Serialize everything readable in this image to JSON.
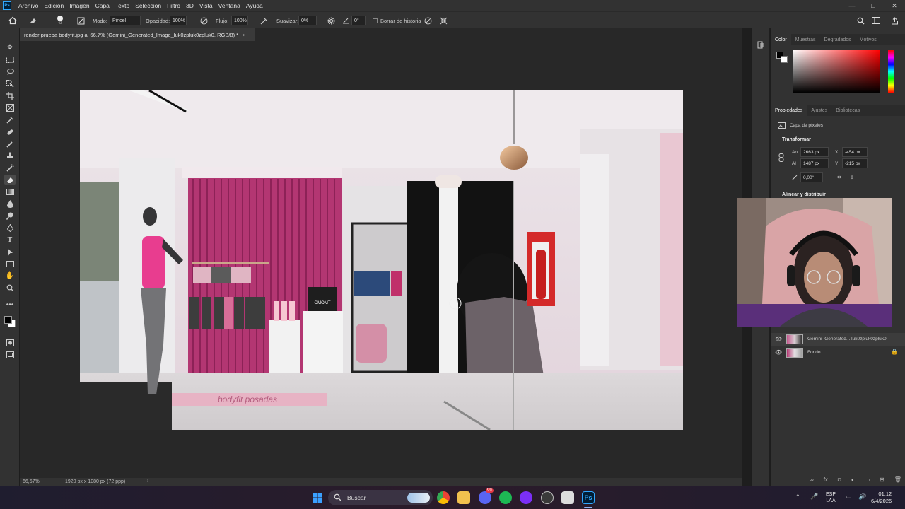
{
  "app": {
    "logo": "Ps"
  },
  "menu": [
    "Archivo",
    "Edición",
    "Imagen",
    "Capa",
    "Texto",
    "Selección",
    "Filtro",
    "3D",
    "Vista",
    "Ventana",
    "Ayuda"
  ],
  "window_controls": {
    "minimize": "—",
    "maximize": "□",
    "close": "✕"
  },
  "options": {
    "brush_size": "43",
    "modo_label": "Modo:",
    "modo_value": "Pincel",
    "opacidad_label": "Opacidad:",
    "opacidad_value": "100%",
    "flujo_label": "Flujo:",
    "flujo_value": "100%",
    "suavizar_label": "Suavizar:",
    "suavizar_value": "0%",
    "angle_value": "0°",
    "borrar_historia": "Borrar de historia"
  },
  "document": {
    "tab_title": "render prueba bodyfit.jpg al 66,7% (Gemini_Generated_Image_luk0zpluk0zpluk0, RGB/8) *",
    "tab_close": "×",
    "floor_text": "bodyfit posadas",
    "box_label": "OMOMT"
  },
  "color_panel": {
    "tabs": [
      "Color",
      "Muestras",
      "Degradados",
      "Motivos"
    ],
    "accent_red": "#ff0000"
  },
  "properties_panel": {
    "tabs": [
      "Propiedades",
      "Ajustes",
      "Bibliotecas"
    ],
    "layer_type": "Capa de píxeles",
    "section_transform": "Transformar",
    "an_label": "An",
    "an_value": "2663 px",
    "x_label": "X",
    "x_value": "-454 px",
    "al_label": "Al",
    "al_value": "1487 px",
    "y_label": "Y",
    "y_value": "-215 px",
    "angle_value": "0,00°",
    "section_align": "Alinear y distribuir"
  },
  "layers_panel": {
    "layers": [
      {
        "name": "Gemini_Generated....luk0zpluk0zpluk0",
        "visible": true
      },
      {
        "name": "Fondo",
        "visible": true,
        "locked": true
      }
    ]
  },
  "status": {
    "zoom": "66,67%",
    "doc_size": "1920 px x 1080 px (72 ppp)"
  },
  "taskbar": {
    "search_placeholder": "Buscar",
    "lang_top": "ESP",
    "lang_bottom": "LAA",
    "time": "01:12",
    "date": "6/4/2026",
    "discord_badge": "99"
  }
}
